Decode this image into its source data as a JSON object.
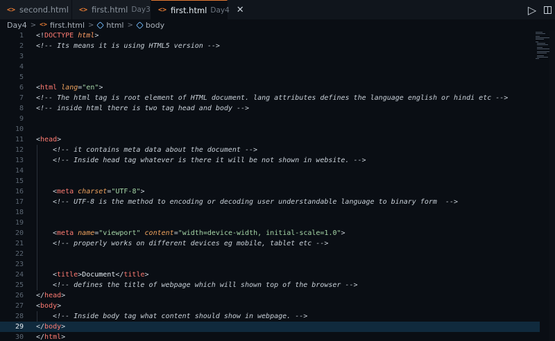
{
  "tabs": [
    {
      "label": "second.html",
      "description": "",
      "icon": "html-file-icon",
      "active": false
    },
    {
      "label": "first.html",
      "description": "Day3",
      "icon": "html-file-icon",
      "active": false
    },
    {
      "label": "first.html",
      "description": "Day4",
      "icon": "html-file-icon",
      "active": true
    }
  ],
  "tab_icon_glyph": "<>",
  "close_glyph": "✕",
  "run_glyph": "▷",
  "breadcrumb": {
    "folder": "Day4",
    "file": "first.html",
    "path": [
      "html",
      "body"
    ],
    "separator": ">"
  },
  "editor": {
    "current_line": 29,
    "lines": [
      {
        "n": "1"
      },
      {
        "n": "2"
      },
      {
        "n": "3"
      },
      {
        "n": "4"
      },
      {
        "n": "5"
      },
      {
        "n": "6"
      },
      {
        "n": "7"
      },
      {
        "n": "8"
      },
      {
        "n": "9"
      },
      {
        "n": "10"
      },
      {
        "n": "11"
      },
      {
        "n": "12"
      },
      {
        "n": "13"
      },
      {
        "n": "14"
      },
      {
        "n": "15"
      },
      {
        "n": "16"
      },
      {
        "n": "17"
      },
      {
        "n": "18"
      },
      {
        "n": "19"
      },
      {
        "n": "20"
      },
      {
        "n": "21"
      },
      {
        "n": "22"
      },
      {
        "n": "23"
      },
      {
        "n": "24"
      },
      {
        "n": "25"
      },
      {
        "n": "26"
      },
      {
        "n": "27"
      },
      {
        "n": "28"
      },
      {
        "n": "29"
      },
      {
        "n": "30"
      }
    ],
    "text": {
      "doctype_open": "<!",
      "doctype_kw": "DOCTYPE",
      "doctype_val": "html",
      "gt": ">",
      "lt": "<",
      "lt_slash": "</",
      "eq": "=",
      "html": "html",
      "head": "head",
      "body": "body",
      "meta": "meta",
      "title": "title",
      "lang": "lang",
      "lang_val": "\"en\"",
      "charset": "charset",
      "charset_val": "\"UTF-8\"",
      "name": "name",
      "name_val": "\"viewport\"",
      "content": "content",
      "content_val": "\"width=device-width, initial-scale=1.0\"",
      "title_text": "Document",
      "c2": "<!-- Its means it is using HTML5 version -->",
      "c7": "<!-- The html tag is root element of HTML document. lang attributes defines the language english or hindi etc -->",
      "c8": "<!-- inside html there is two tag head and body -->",
      "c12": "<!-- it contains meta data about the document -->",
      "c13": "<!-- Inside head tag whatever is there it will be not shown in website. -->",
      "c17": "<!-- UTF-8 is the method to encoding or decoding user understandable language to binary form  -->",
      "c20": "<!-- properly works on different devices eg mobile, tablet etc -->",
      "c25": "<!-- defines the title of webpage which will shown top of the browser -->",
      "c28": "<!-- Inside body tag what content should show in webpage. -->"
    }
  },
  "colors": {
    "accent": "#e37933",
    "background": "#0a0e14",
    "current_line": "#102a3d"
  }
}
